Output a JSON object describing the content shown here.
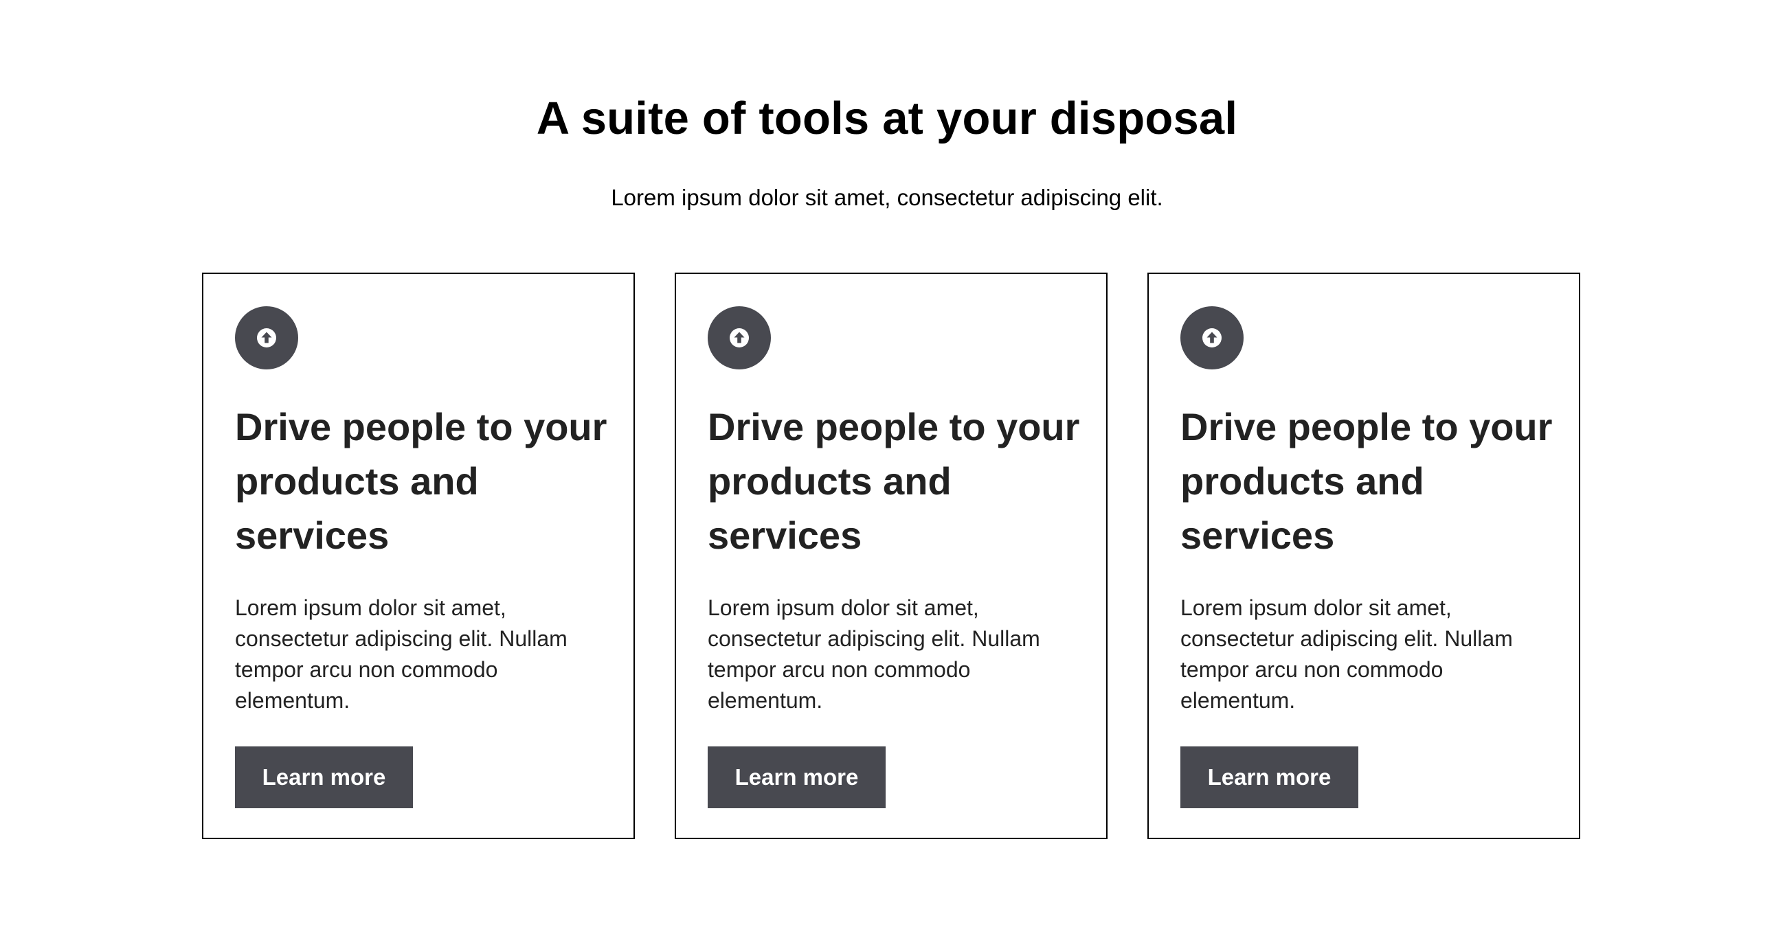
{
  "header": {
    "title": "A suite of tools at your disposal",
    "subtitle": "Lorem ipsum dolor sit amet, consectetur adipiscing elit."
  },
  "cards": [
    {
      "icon": "arrow-up-circle-icon",
      "title": "Drive people to your products and services",
      "text": "Lorem ipsum dolor sit amet, consectetur adipiscing elit. Nullam tempor arcu non commodo elementum.",
      "button_label": "Learn more"
    },
    {
      "icon": "arrow-up-circle-icon",
      "title": "Drive people to your products and services",
      "text": "Lorem ipsum dolor sit amet, consectetur adipiscing elit. Nullam tempor arcu non commodo elementum.",
      "button_label": "Learn more"
    },
    {
      "icon": "arrow-up-circle-icon",
      "title": "Drive people to your products and services",
      "text": "Lorem ipsum dolor sit amet, consectetur adipiscing elit. Nullam tempor arcu non commodo elementum.",
      "button_label": "Learn more"
    }
  ],
  "colors": {
    "accent": "#484950",
    "text": "#222222",
    "border": "#000000",
    "background": "#ffffff"
  }
}
